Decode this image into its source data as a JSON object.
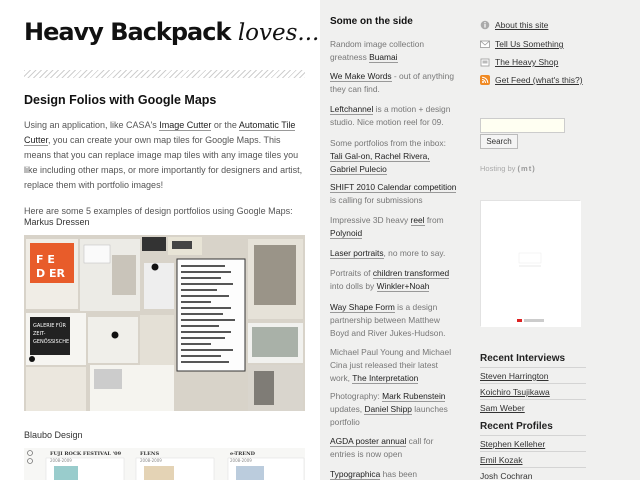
{
  "site": {
    "title_bold": "Heavy Backpack",
    "title_rest": "loves..."
  },
  "post": {
    "title": "Design Folios with Google Maps",
    "p1_before": "Using an application, like CASA's ",
    "p1_link1": "Image Cutter",
    "p1_mid": " or the ",
    "p1_link2": "Automatic Tile Cutter",
    "p1_after": ", you can create your own map tiles for Google Maps. This means that you can replace image map tiles with any image tiles you like including other maps, or more importantly for designers and artist, replace them with portfolio images!",
    "p2": "Here are some 5 examples of design portfolios using Google Maps:",
    "caption1": "Markus Dressen",
    "caption2": "Blaubo Design",
    "thumb_labels": [
      "FUJI ROCK FESTIVAL '09",
      "FLENS",
      "e-TREND"
    ],
    "thumb_dates": [
      "2008-2009",
      "2008-2009",
      "2008-2009"
    ]
  },
  "mid": {
    "heading": "Some on the side",
    "items": [
      {
        "pre": "Random image collection greatness ",
        "link": "Buamai",
        "post": ""
      },
      {
        "pre": "",
        "link": "We Make Words",
        "post": " - out of anything they can find."
      },
      {
        "pre": "",
        "link": "Leftchannel",
        "post": " is a motion + design studio. Nice motion reel for 09."
      },
      {
        "pre": "Some portfolios from the inbox: ",
        "link": "Tali Gal-on, Rachel Rivera, Gabriel Pulecio",
        "post": ""
      },
      {
        "pre": "",
        "link": "SHIFT 2010 Calendar competition",
        "post": " is calling for submissions"
      },
      {
        "pre": "Impressive 3D heavy ",
        "link": "reel",
        "post": " from ",
        "link2": "Polynoid"
      },
      {
        "pre": "",
        "link": "Laser portraits",
        "post": ", no more to say."
      },
      {
        "pre": "Portraits of ",
        "link": "children transformed",
        "post": " into dolls by ",
        "link2": "Winkler+Noah"
      },
      {
        "pre": "",
        "link": "Way Shape Form",
        "post": " is a design partnership between Matthew Boyd and River Jukes-Hudson."
      },
      {
        "pre": "Michael Paul Young and Michael Cina just released their latest work, ",
        "link": "The Interpretation",
        "post": ""
      },
      {
        "pre": "Photography: ",
        "link": "Mark Rubenstein",
        "post": " updates, ",
        "link2": "Daniel Shipp",
        "post2": " launches portfolio"
      },
      {
        "pre": "",
        "link": "AGDA poster annual",
        "post": " call for entries is now open"
      },
      {
        "pre": "",
        "link": "Typographica",
        "post": " has been"
      }
    ]
  },
  "right": {
    "meta": [
      {
        "label": "About this site",
        "icon": "info-icon"
      },
      {
        "label": "Tell Us Something",
        "icon": "mail-icon"
      },
      {
        "label": "The Heavy Shop",
        "icon": "shop-icon"
      },
      {
        "label": "Get Feed (what's this?)",
        "icon": "rss-icon"
      }
    ],
    "search_value": "",
    "search_label": "Search",
    "hosting_label": "Hosting by",
    "hosting_brand": "(mt)",
    "interviews_title": "Recent Interviews",
    "interviews": [
      "Steven Harrington",
      "Koichiro Tsujikawa",
      "Sam Weber"
    ],
    "profiles_title": "Recent Profiles",
    "profiles": [
      "Stephen Kelleher",
      "Emil Kozak",
      "Josh Cochran"
    ]
  },
  "colors": {
    "rss": "#f08a24",
    "accent_red": "#d22",
    "link_underline": "#999999"
  }
}
